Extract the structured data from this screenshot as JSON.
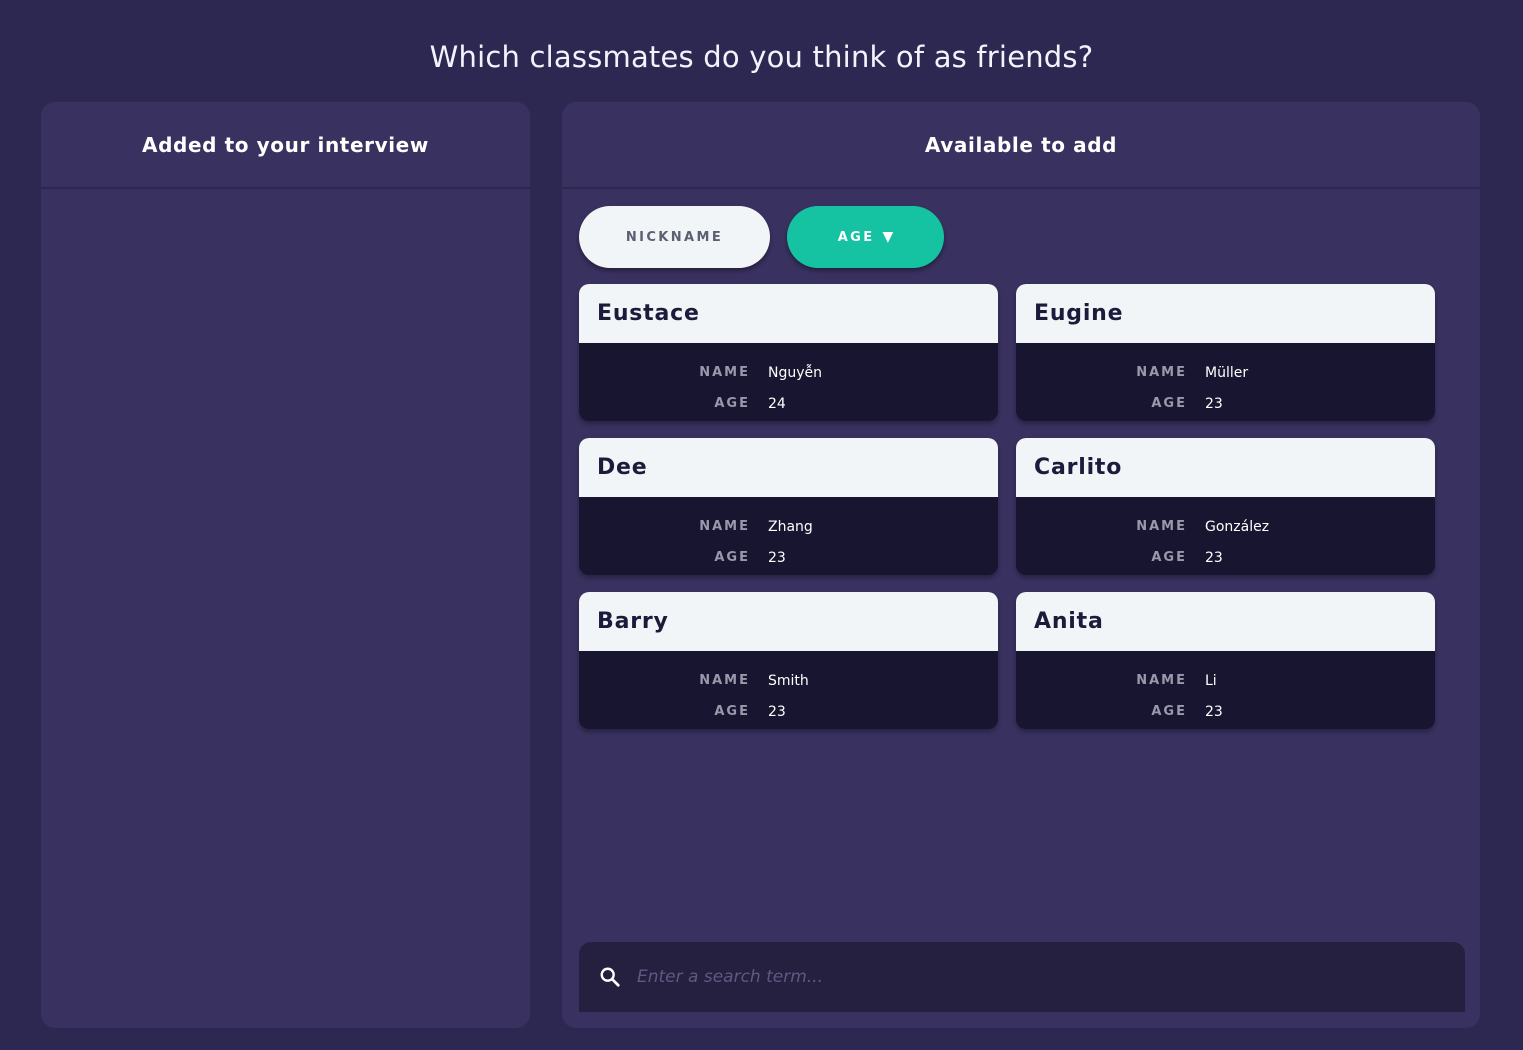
{
  "prompt": "Which classmates do you think of as friends?",
  "left_panel": {
    "title": "Added to your interview"
  },
  "right_panel": {
    "title": "Available to add",
    "sort": {
      "nickname_label": "NICKNAME",
      "age_label": "AGE",
      "age_arrow": "▼"
    }
  },
  "cards": [
    {
      "nickname": "Eustace",
      "name_label": "NAME",
      "name": "Nguyễn",
      "age_label": "AGE",
      "age": "24"
    },
    {
      "nickname": "Eugine",
      "name_label": "NAME",
      "name": "Müller",
      "age_label": "AGE",
      "age": "23"
    },
    {
      "nickname": "Dee",
      "name_label": "NAME",
      "name": "Zhang",
      "age_label": "AGE",
      "age": "23"
    },
    {
      "nickname": "Carlito",
      "name_label": "NAME",
      "name": "González",
      "age_label": "AGE",
      "age": "23"
    },
    {
      "nickname": "Barry",
      "name_label": "NAME",
      "name": "Smith",
      "age_label": "AGE",
      "age": "23"
    },
    {
      "nickname": "Anita",
      "name_label": "NAME",
      "name": "Li",
      "age_label": "AGE",
      "age": "23"
    }
  ],
  "search": {
    "placeholder": "Enter a search term..."
  },
  "colors": {
    "accent": "#15c2a2",
    "background": "#2d2852",
    "panel": "#39315f",
    "card_body": "#171530"
  }
}
